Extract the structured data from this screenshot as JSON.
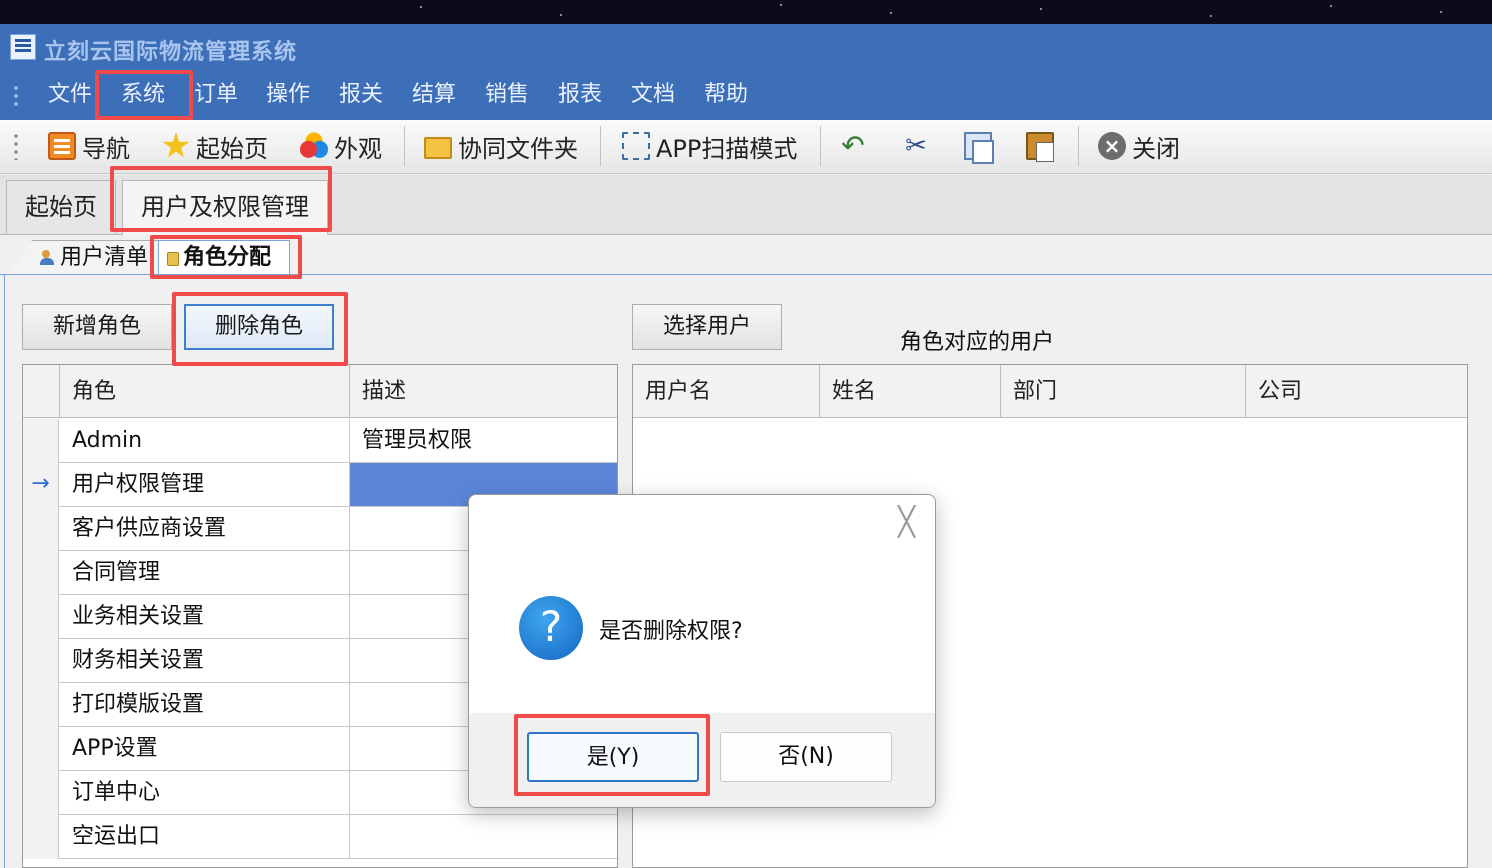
{
  "app": {
    "title": "立刻云国际物流管理系统"
  },
  "menu": [
    "文件",
    "系统",
    "订单",
    "操作",
    "报关",
    "结算",
    "销售",
    "报表",
    "文档",
    "帮助"
  ],
  "toolbar": {
    "nav": "导航",
    "start": "起始页",
    "appearance": "外观",
    "shared_folder": "协同文件夹",
    "app_scan": "APP扫描模式",
    "close": "关闭",
    "icons": [
      "navigation-icon",
      "star-icon",
      "appearance-icon",
      "folder-icon",
      "scan-icon",
      "undo-icon",
      "cut-icon",
      "copy-icon",
      "paste-icon",
      "close-icon"
    ]
  },
  "main_tabs": [
    "起始页",
    "用户及权限管理"
  ],
  "sub_tabs": [
    "用户清单",
    "角色分配"
  ],
  "buttons": {
    "add_role": "新增角色",
    "delete_role": "删除角色",
    "select_user": "选择用户"
  },
  "role_user_title": "角色对应的用户",
  "role_grid": {
    "headers": [
      "角色",
      "描述"
    ],
    "rows": [
      {
        "role": "Admin",
        "desc": "管理员权限"
      },
      {
        "role": "用户权限管理",
        "desc": ""
      },
      {
        "role": "客户供应商设置",
        "desc": ""
      },
      {
        "role": "合同管理",
        "desc": ""
      },
      {
        "role": "业务相关设置",
        "desc": ""
      },
      {
        "role": "财务相关设置",
        "desc": ""
      },
      {
        "role": "打印模版设置",
        "desc": ""
      },
      {
        "role": "APP设置",
        "desc": ""
      },
      {
        "role": "订单中心",
        "desc": ""
      },
      {
        "role": "空运出口",
        "desc": ""
      }
    ],
    "current_row_marker": "→"
  },
  "user_grid": {
    "headers": [
      "用户名",
      "姓名",
      "部门",
      "公司"
    ]
  },
  "dialog": {
    "message": "是否删除权限?",
    "yes": "是(Y)",
    "no": "否(N)",
    "close_glyph": "╳",
    "question_glyph": "?"
  },
  "colors": {
    "title_bar": "#3c6fb8",
    "selection": "#5b86d8",
    "highlight": "#f04a4a"
  }
}
